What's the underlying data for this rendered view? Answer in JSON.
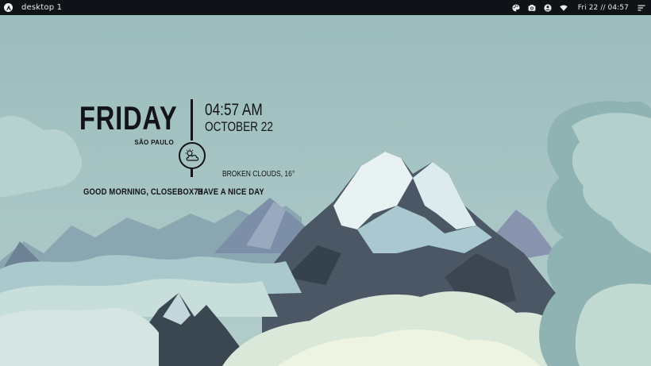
{
  "topbar": {
    "workspace_label": "desktop 1",
    "clock": "Fri 22 // 04:57",
    "icons": {
      "launcher": "arch-logo-icon",
      "palette": "palette-icon",
      "screenshot": "camera-icon",
      "account": "user-circle-icon",
      "network": "wifi-icon",
      "menu": "menu-lines-icon"
    }
  },
  "widget": {
    "day": "FRIDAY",
    "city": "SÃO PAULO",
    "time": "04:57 AM",
    "date": "OCTOBER 22",
    "weather_icon": "partly-cloudy-icon",
    "weather": "BROKEN CLOUDS, 16°",
    "greeting": "GOOD MORNING, CLOSEBOX73",
    "message": "HAVE A NICE DAY"
  },
  "colors": {
    "topbar_bg": "#0f1216",
    "sky": "#9fc0c0",
    "text": "#121417"
  }
}
